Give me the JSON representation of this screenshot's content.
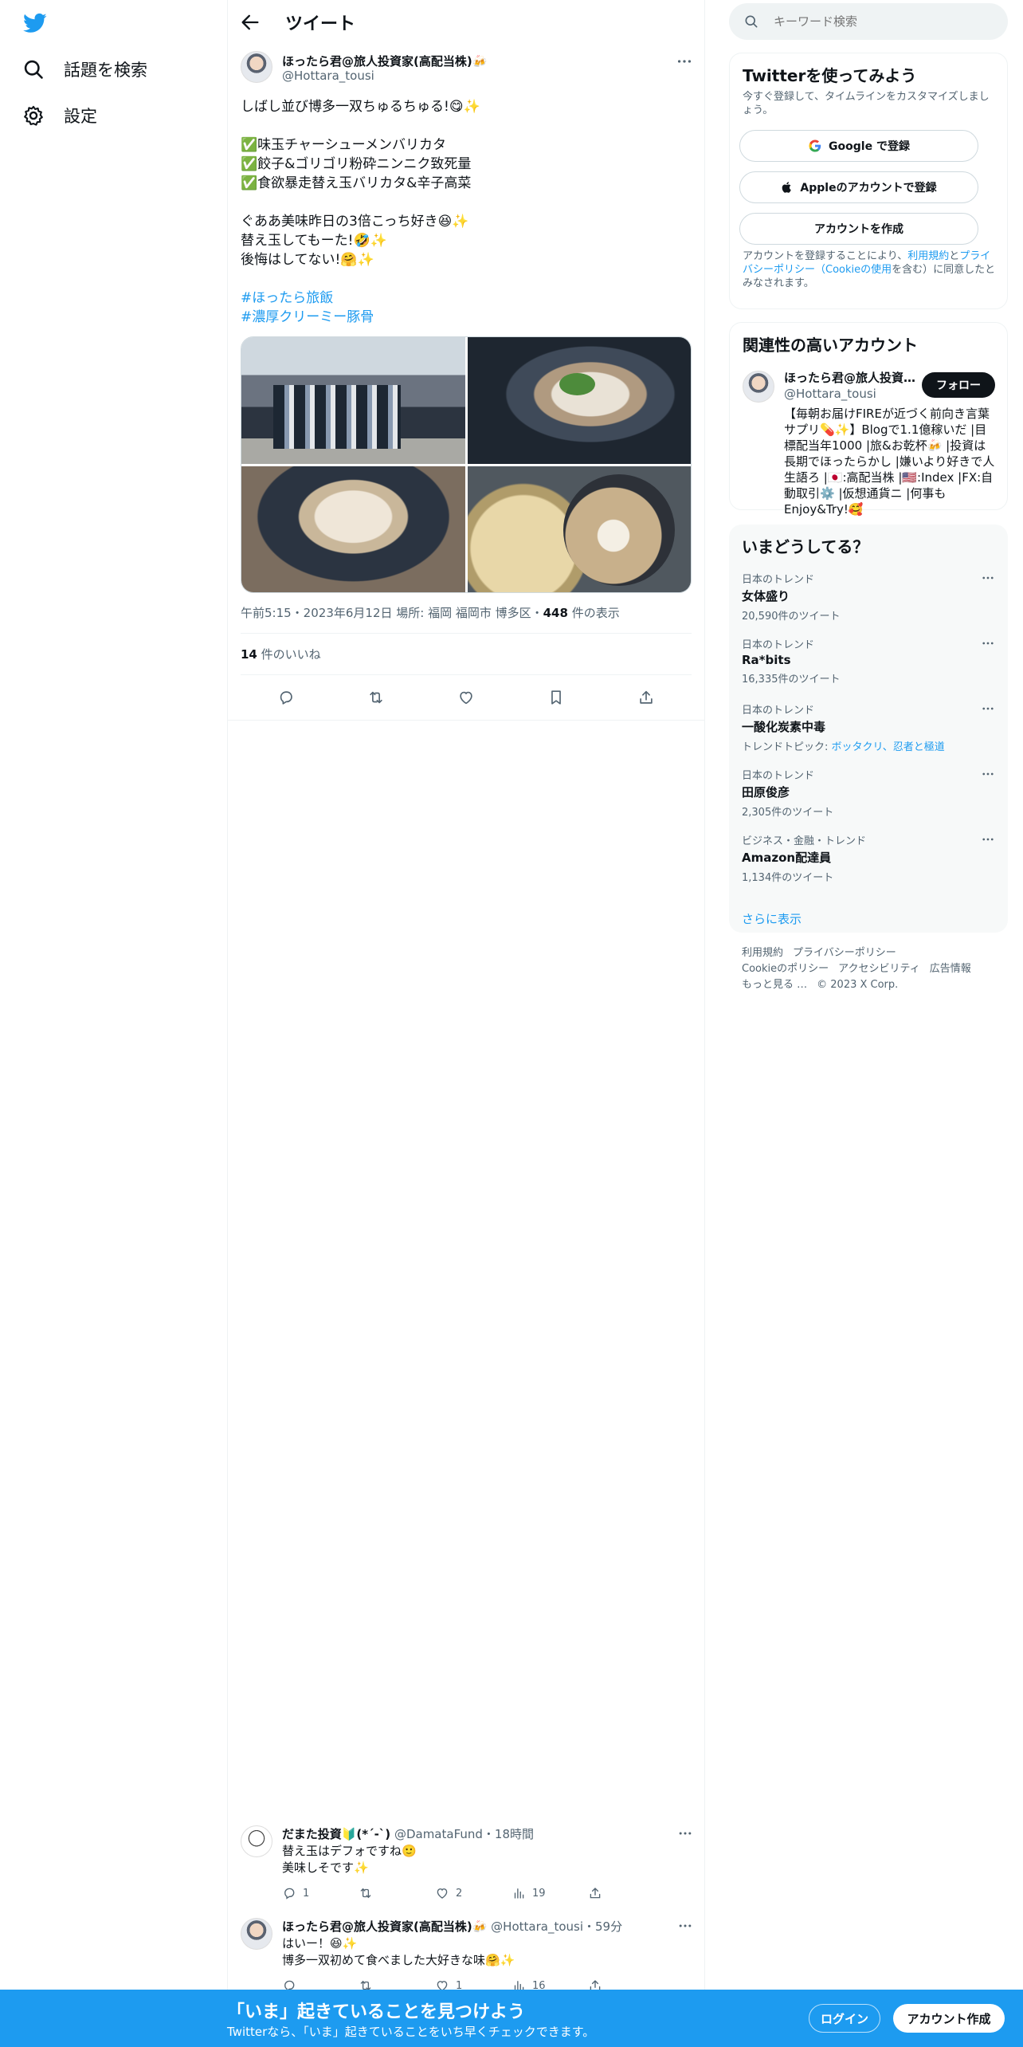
{
  "nav": {
    "search_label": "話題を検索",
    "settings_label": "設定"
  },
  "header": {
    "title": "ツイート"
  },
  "tweet": {
    "name": "ほったら君@旅人投資家(高配当株)🍻",
    "handle": "@Hottara_tousi",
    "text": "しばし並び博多一双ちゅるちゅる!😋✨\n\n✅味玉チャーシューメンバリカタ\n✅餃子&ゴリゴリ粉砕ニンニク致死量\n✅食欲暴走替え玉バリカタ&辛子高菜\n\nぐああ美味昨日の3倍こっち好き😆✨\n替え玉してもーた!🤣✨\n後悔はしてない!🤗✨",
    "hashtags": [
      "#ほったら旅飯",
      "#濃厚クリーミー豚骨"
    ],
    "meta_prefix": "午前5:15・2023年6月12日 場所: 福岡 福岡市 博多区・",
    "views_count": "448",
    "views_label": " 件の表示",
    "likes_count": "14",
    "likes_label": " 件のいいね"
  },
  "replies": [
    {
      "name": "だまた投資🔰(*´-`)",
      "handle": "@DamataFund",
      "time": "・18時間",
      "text": "替え玉はデフォですね🙂\n美味しそです✨",
      "replies": "1",
      "retweets": "",
      "likes": "2",
      "views": "19"
    },
    {
      "name": "ほったら君@旅人投資家(高配当株)🍻",
      "handle": "@Hottara_tousi",
      "time": "・59分",
      "text": "はいー！😆✨\n博多一双初めて食べました大好きな味🤗✨",
      "replies": "",
      "retweets": "",
      "likes": "1",
      "views": "16"
    }
  ],
  "search": {
    "placeholder": "キーワード検索"
  },
  "signup": {
    "title": "Twitterを使ってみよう",
    "subtitle": "今すぐ登録して、タイムラインをカスタマイズしましょう。",
    "google_label": "Google で登録",
    "apple_label": "Appleのアカウントで登録",
    "create_label": "アカウントを作成",
    "terms_1": "アカウントを登録することにより、",
    "terms_link1": "利用規約",
    "terms_2": "と",
    "terms_link2": "プライバシーポリシー（Cookieの使用",
    "terms_3": "を含む）に同意したとみなされます。"
  },
  "reco": {
    "title": "関連性の高いアカウント",
    "name": "ほったら君@旅人投資家(高配当株)",
    "handle": "@Hottara_tousi",
    "follow_label": "フォロー",
    "bio": "【毎朝お届けFIREが近づく前向き言葉サプリ💊✨】Blogで1.1億稼いだ |目標配当年1000 |旅&お乾杯🍻 |投資は長期でほったらかし |嫌いより好きで人生語ろ |🇯🇵:高配当株 |🇺🇸:Index |FX:自動取引⚙️ |仮想通貨ニ |何事もEnjoy&Try!🥰"
  },
  "trends": {
    "title": "いまどうしてる？",
    "items": [
      {
        "category": "日本のトレンド",
        "title": "女体盛り",
        "count": "20,590件のツイート"
      },
      {
        "category": "日本のトレンド",
        "title": "Ra*bits",
        "count": "16,335件のツイート"
      },
      {
        "category": "日本のトレンド",
        "title": "一酸化炭素中毒",
        "count_prefix": "トレンドトピック: ",
        "count_link": "ボッタクリ、忍者と極道"
      },
      {
        "category": "日本のトレンド",
        "title": "田原俊彦",
        "count": "2,305件のツイート"
      },
      {
        "category": "ビジネス・金融・トレンド",
        "title": "Amazon配達員",
        "count": "1,134件のツイート"
      }
    ],
    "show_more": "さらに表示"
  },
  "footer": {
    "links": [
      "利用規約",
      "プライバシーポリシー",
      "Cookieのポリシー",
      "アクセシビリティ",
      "広告情報",
      "もっと見る …"
    ],
    "copyright": "© 2023 X Corp."
  },
  "bottombar": {
    "title": "「いま」起きていることを見つけよう",
    "subtitle": "Twitterなら、「いま」起きていることをいち早くチェックできます。",
    "login_label": "ログイン",
    "signup_label": "アカウント作成"
  },
  "colors": {
    "accent": "#1d9bf0",
    "text": "#0f1419",
    "muted": "#536471"
  }
}
